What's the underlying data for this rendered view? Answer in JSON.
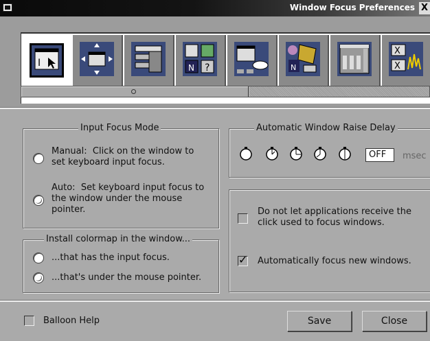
{
  "window": {
    "title": "Window Focus Preferences",
    "close_glyph": "X"
  },
  "toolbar": {
    "icons": [
      "focus-mode-icon",
      "window-move-icon",
      "window-list-icon",
      "palette-icon",
      "workspace-icon",
      "desktop-icon",
      "menu-config-icon",
      "misc-icon"
    ]
  },
  "input_focus": {
    "legend": "Input Focus Mode",
    "manual_label": "Manual:  Click on the window to\nset keyboard input focus.",
    "auto_label": "Auto:  Set keyboard input focus to\nthe window under the mouse\npointer.",
    "selected": "auto"
  },
  "colormap": {
    "legend": "Install colormap in the window...",
    "option1": "...that has the input focus.",
    "option2": "...that's under the mouse pointer.",
    "selected": "option2"
  },
  "raise_delay": {
    "legend": "Automatic Window Raise Delay",
    "value": "OFF",
    "unit": "msec",
    "selected_index": 0
  },
  "options": {
    "no_click_focus_label": "Do not let applications receive the\nclick used to focus windows.",
    "no_click_focus_checked": false,
    "auto_focus_new_label": "Automatically focus new windows.",
    "auto_focus_new_checked": true
  },
  "footer": {
    "balloon_help": "Balloon Help",
    "balloon_checked": false,
    "save": "Save",
    "close": "Close"
  }
}
